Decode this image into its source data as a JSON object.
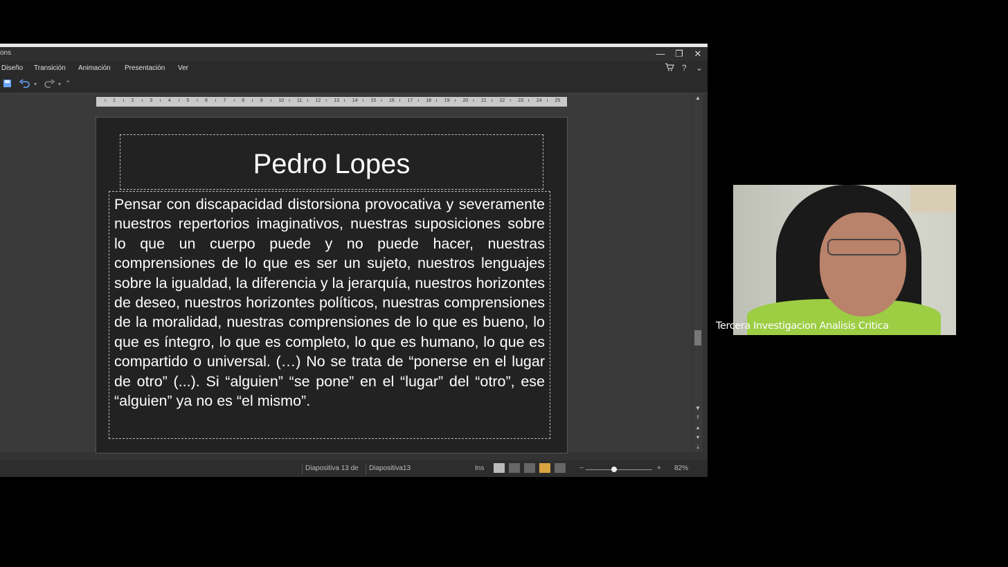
{
  "window": {
    "title_fragment": "ons",
    "minimize": "—",
    "restore": "❐",
    "close": "✕"
  },
  "menu": {
    "tabs": [
      "Diseño",
      "Transición",
      "Animación",
      "Presentación",
      "Ver"
    ],
    "cart_icon": "cart-icon",
    "help": "?",
    "chevron": "⌄"
  },
  "ruler": {
    "numbers": [
      "1",
      "2",
      "3",
      "4",
      "5",
      "6",
      "7",
      "8",
      "9",
      "10",
      "11",
      "12",
      "13",
      "14",
      "15",
      "16",
      "17",
      "18",
      "19",
      "20",
      "21",
      "22",
      "23",
      "24",
      "25"
    ]
  },
  "slide": {
    "title": "Pedro Lopes",
    "body": "Pensar con discapacidad distorsiona provocativa y severamente nuestros repertorios imaginativos, nuestras suposiciones sobre lo que un cuerpo puede y no puede hacer, nuestras comprensiones de lo que es ser un sujeto, nuestros lenguajes sobre la igualdad, la diferencia y la jerarquía, nuestros horizontes de deseo, nuestros horizontes políticos, nuestras comprensiones de la moralidad, nuestras comprensiones de lo que es bueno, lo que es íntegro, lo que es completo, lo que es humano, lo que es compartido o universal. (…) No se trata de “ponerse en el lugar de otro” (...). Si “alguien” “se pone” en el “lugar” del “otro”, ese “alguien” ya no es “el mismo”."
  },
  "status": {
    "slide_position": "Diapositiva 13 de",
    "slide_name": "Diapositiva13",
    "insert_mode": "Ins",
    "zoom_minus": "−",
    "zoom_plus": "+",
    "zoom_percent": "82%",
    "zoom_level": 0.82
  },
  "video": {
    "participant_name": "Tercera Investigacion Analisis Critica"
  }
}
